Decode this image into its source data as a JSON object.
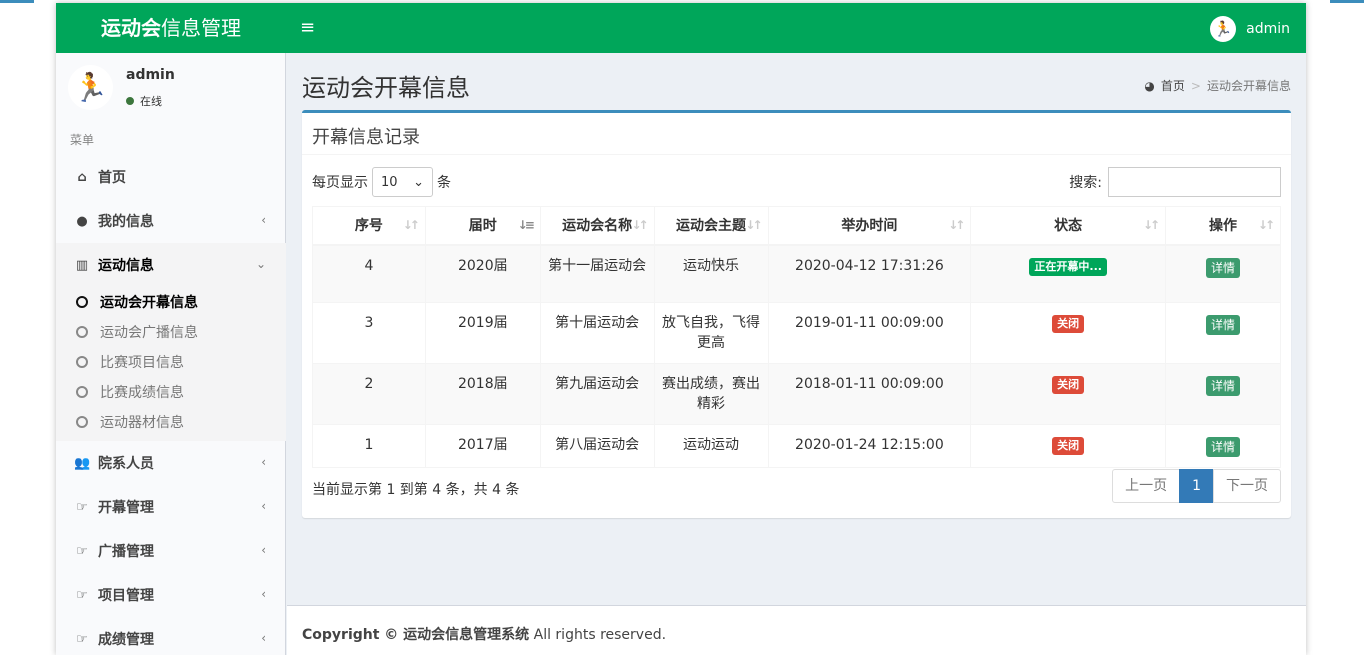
{
  "header": {
    "logo_bold": "运动会",
    "logo_rest": "信息管理",
    "toggle_icon": "≡",
    "username": "admin"
  },
  "sidebar": {
    "user_name": "admin",
    "user_status": "在线",
    "menu_header": "菜单",
    "items": [
      {
        "label": "首页",
        "icon": "home-icon"
      },
      {
        "label": "我的信息",
        "icon": "user-icon"
      },
      {
        "label": "运动信息",
        "icon": "bar-chart-icon"
      },
      {
        "label": "院系人员",
        "icon": "users-icon"
      },
      {
        "label": "开幕管理",
        "icon": "hand-point-icon"
      },
      {
        "label": "广播管理",
        "icon": "hand-point-icon"
      },
      {
        "label": "项目管理",
        "icon": "hand-point-icon"
      },
      {
        "label": "成绩管理",
        "icon": "hand-point-icon"
      }
    ],
    "submenu": [
      {
        "label": "运动会开幕信息"
      },
      {
        "label": "运动会广播信息"
      },
      {
        "label": "比赛项目信息"
      },
      {
        "label": "比赛成绩信息"
      },
      {
        "label": "运动器材信息"
      }
    ]
  },
  "content": {
    "page_title": "运动会开幕信息",
    "breadcrumb_home": "首页",
    "breadcrumb_sep": ">",
    "breadcrumb_current": "运动会开幕信息",
    "box_title": "开幕信息记录",
    "length_prefix": "每页显示",
    "length_value": "10",
    "length_suffix": "条",
    "search_label": "搜索:",
    "columns": [
      "序号",
      "届时",
      "运动会名称",
      "运动会主题",
      "举办时间",
      "状态",
      "操作"
    ],
    "rows": [
      {
        "no": "4",
        "session": "2020届",
        "name": "第十一届运动会",
        "theme": "运动快乐",
        "time": "2020-04-12 17:31:26",
        "status": "正在开幕中...",
        "action": "详情"
      },
      {
        "no": "3",
        "session": "2019届",
        "name": "第十届运动会",
        "theme": "放飞自我，飞得更高",
        "time": "2019-01-11 00:09:00",
        "status": "关闭",
        "action": "详情"
      },
      {
        "no": "2",
        "session": "2018届",
        "name": "第九届运动会",
        "theme": "赛出成绩，赛出精彩",
        "time": "2018-01-11 00:09:00",
        "status": "关闭",
        "action": "详情"
      },
      {
        "no": "1",
        "session": "2017届",
        "name": "第八届运动会",
        "theme": "运动运动",
        "time": "2020-01-24 12:15:00",
        "status": "关闭",
        "action": "详情"
      }
    ],
    "info_text": "当前显示第 1 到第 4 条，共 4 条",
    "pager": {
      "prev": "上一页",
      "current": "1",
      "next": "下一页"
    }
  },
  "footer": {
    "copyright_bold": "Copyright © 运动会信息管理系统",
    "copyright_rest": " All rights reserved."
  },
  "colors": {
    "header_green": "#00a65a",
    "box_blue": "#3c8dbc",
    "pager_active": "#337ab7",
    "badge_green": "#00a65a",
    "badge_red": "#dd4b39",
    "detail_button": "#3c9b6e"
  }
}
